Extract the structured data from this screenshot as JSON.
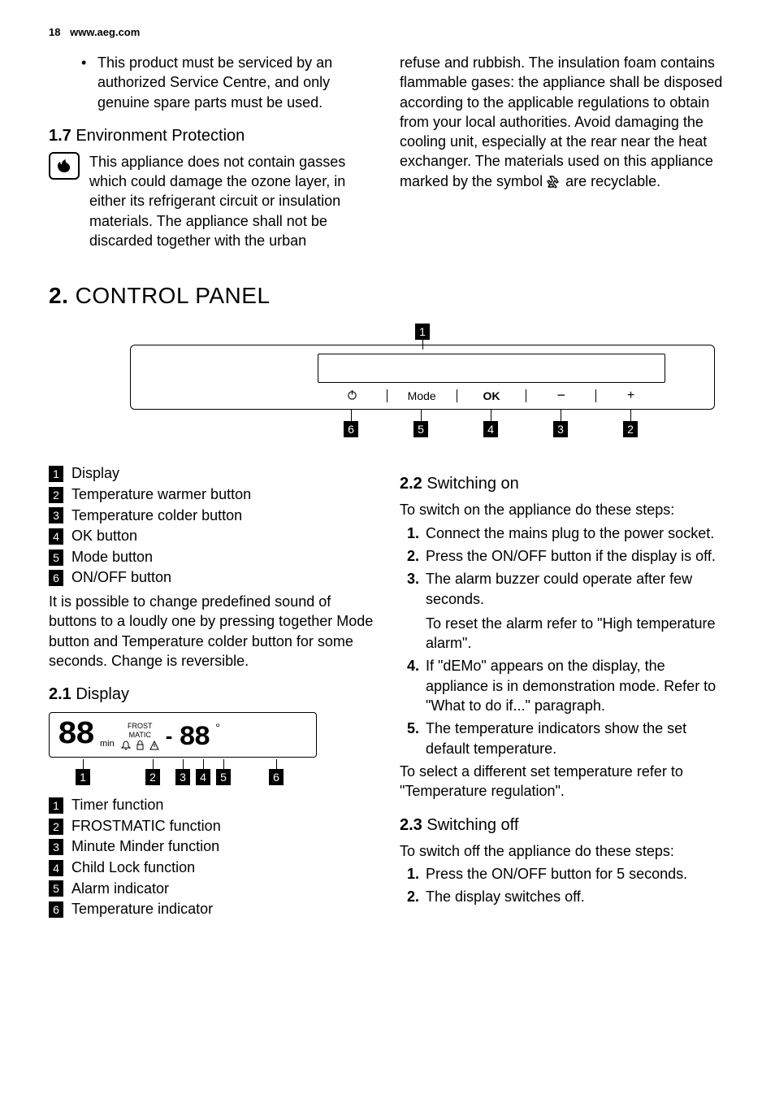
{
  "header": {
    "page": "18",
    "url": "www.aeg.com"
  },
  "bullet1": "This product must be serviced by an authorized Service Centre, and only genuine spare parts must be used.",
  "s17": {
    "num": "1.7",
    "title": "Environment Protection",
    "col1": "This appliance does not contain gasses which could damage the ozone layer, in either its refrigerant circuit or insulation materials. The appliance shall not be discarded together with the urban",
    "col2a": "refuse and rubbish. The insulation foam contains flammable gases: the appliance shall be disposed according to the applicable regulations to obtain from your local authorities. Avoid damaging the cooling unit, especially at the rear near the heat exchanger. The materials used on this appliance marked by the symbol ",
    "col2b": " are recyclable."
  },
  "s2": {
    "num": "2.",
    "title": "CONTROL PANEL"
  },
  "cp_buttons": {
    "b1_glyph": "⭘",
    "b2": "Mode",
    "b3": "OK",
    "b4": "−",
    "b5": "+"
  },
  "cp_legend": [
    "Display",
    "Temperature warmer button",
    "Temperature colder button",
    "OK button",
    "Mode button",
    "ON/OFF button"
  ],
  "cp_note": "It is possible to change predefined sound of buttons to a loudly one by pressing together Mode button and Temperature colder button for some seconds. Change is reversible.",
  "s21": {
    "num": "2.1",
    "title": "Display"
  },
  "disp": {
    "seg_left": "88",
    "min": "min",
    "frost1": "FROST",
    "frost2": "MATIC",
    "seg_right": "88"
  },
  "disp_legend": [
    "Timer function",
    "FROSTMATIC function",
    "Minute Minder function",
    "Child Lock function",
    "Alarm indicator",
    "Temperature indicator"
  ],
  "s22": {
    "num": "2.2",
    "title": "Switching on",
    "intro": "To switch on the appliance do these steps:",
    "items": [
      "Connect the mains plug to the power socket.",
      "Press the ON/OFF button if the display is off.",
      "The alarm buzzer could operate after few seconds.",
      "If \"dEMo\" appears on the display, the appliance is in demonstration mode. Refer to \"What to do if...\" paragraph.",
      "The temperature indicators show the set default temperature."
    ],
    "sub3": "To reset the alarm refer to \"High temperature alarm\".",
    "outro": "To select a different set temperature refer to \"Temperature regulation\"."
  },
  "s23": {
    "num": "2.3",
    "title": "Switching off",
    "intro": "To switch off the appliance do these steps:",
    "items": [
      "Press the ON/OFF button for 5 seconds.",
      "The display switches off."
    ]
  },
  "ol_nums": [
    "1.",
    "2.",
    "3.",
    "4.",
    "5."
  ],
  "leg_nums": [
    "1",
    "2",
    "3",
    "4",
    "5",
    "6"
  ]
}
